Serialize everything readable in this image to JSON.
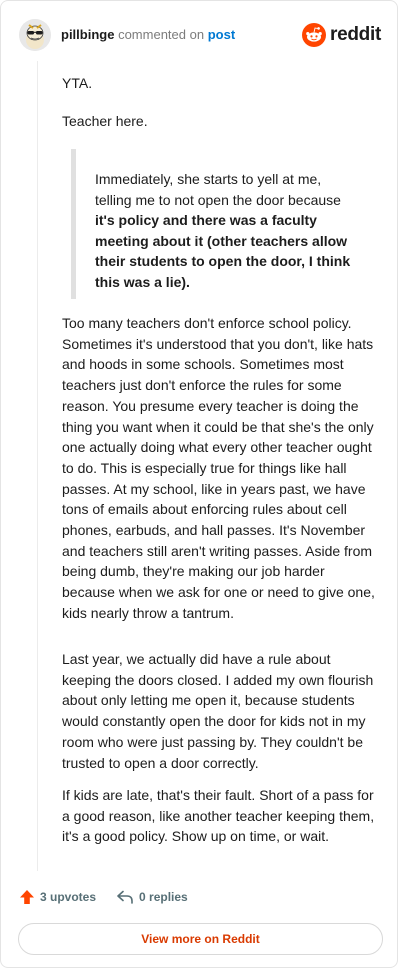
{
  "header": {
    "username": "pillbinge",
    "action_text": "commented on",
    "post_link": "post",
    "brand": "reddit"
  },
  "comment": {
    "line_yta": "YTA.",
    "line_teacher": "Teacher here.",
    "quote": {
      "normal": "Immediately, she starts to yell at me, telling me to not open the door because",
      "bold": "it's policy and there was a faculty meeting about it (other teachers allow their students to open the door, I think this was a lie)."
    },
    "paragraphs": [
      "Too many teachers don't enforce school policy. Sometimes it's understood that you don't, like hats and hoods in some schools. Sometimes most teachers just don't enforce the rules for some reason. You presume every teacher is doing the thing you want when it could be that she's the only one actually doing what every other teacher ought to do. This is especially true for things like hall passes. At my school, like in years past, we have tons of emails about enforcing rules about cell phones, earbuds, and hall passes. It's November and teachers still aren't writing passes. Aside from being dumb, they're making our job harder because when we ask for one or need to give one, kids nearly throw a tantrum.",
      "Last year, we actually did have a rule about keeping the doors closed. I added my own flourish about only letting me open it, because students would constantly open the door for kids not in my room who were just passing by. They couldn't be trusted to open a door correctly.",
      "If kids are late, that's their fault. Short of a pass for a good reason, like another teacher keeping them, it's a good policy. Show up on time, or wait."
    ]
  },
  "actions": {
    "upvotes": "3 upvotes",
    "replies": "0 replies"
  },
  "footer": {
    "view_more": "View more on Reddit"
  },
  "colors": {
    "brand_orange": "#ff4500",
    "link_blue": "#0079d3",
    "button_text": "#d93a00",
    "muted": "#7c7c7c"
  },
  "icons": {
    "avatar": "snoo-avatar-with-sunglasses",
    "logo": "reddit-snoo-icon",
    "upvote": "upvote-arrow-icon",
    "reply": "reply-arrow-icon"
  }
}
